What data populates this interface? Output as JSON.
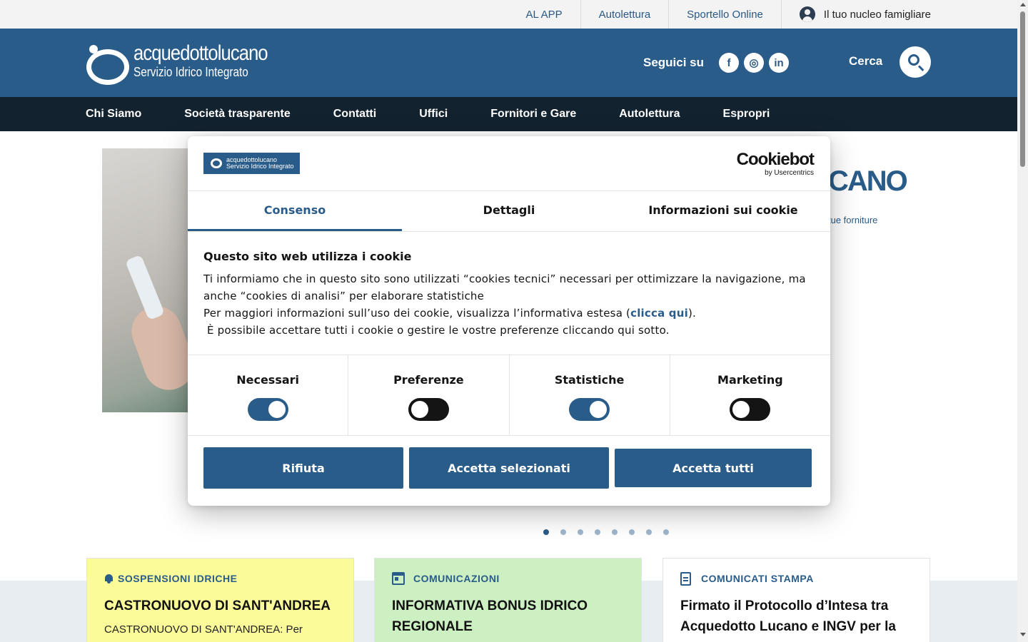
{
  "utility": {
    "links": [
      "AL APP",
      "Autolettura",
      "Sportello Online"
    ],
    "user_label": "Il tuo nucleo famigliare"
  },
  "header": {
    "logo_name_a": "acquedotto",
    "logo_name_b": "lucano",
    "logo_sub": "Servizio Idrico Integrato",
    "follow_label": "Seguici su",
    "social": [
      "f",
      "◎",
      "in"
    ],
    "search_label": "Cerca"
  },
  "nav": {
    "items": [
      "Chi Siamo",
      "Società trasparente",
      "Contatti",
      "Uffici",
      "Fornitori e Gare",
      "Autolettura",
      "Espropri"
    ]
  },
  "hero": {
    "title_fragment": "CANO",
    "subtitle_fragment": "tue forniture"
  },
  "cards": [
    {
      "category": "SOSPENSIONI IDRICHE",
      "title": "CASTRONUOVO DI SANT'ANDREA",
      "text": "CASTRONUOVO DI SANT'ANDREA: Per"
    },
    {
      "category": "COMUNICAZIONI",
      "title": "INFORMATIVA BONUS IDRICO REGIONALE",
      "text": ""
    },
    {
      "category": "COMUNICATI STAMPA",
      "title": "Firmato il Protocollo d’Intesa tra Acquedotto Lucano e INGV per la",
      "text": ""
    }
  ],
  "dialog": {
    "mini_logo_a": "acquedottolucano",
    "mini_logo_b": "Servizio Idrico Integrato",
    "provider_name": "Cookiebot",
    "provider_by": "by Usercentrics",
    "tabs": [
      "Consenso",
      "Dettagli",
      "Informazioni sui cookie"
    ],
    "body_title": "Questo sito web utilizza i cookie",
    "body_line1": "Ti informiamo che in questo sito sono utilizzati “cookies tecnici” necessari per ottimizzare la navigazione, ma anche “cookies di analisi” per elaborare statistiche",
    "body_line2_pre": "Per maggiori informazioni sull’uso dei cookie, visualizza l’informativa estesa (",
    "body_link": "clicca qui",
    "body_line2_post": ").",
    "body_line3": "È possibile accettare tutti i cookie o gestire le vostre preferenze cliccando qui sotto.",
    "toggles": [
      {
        "label": "Necessari",
        "on": true
      },
      {
        "label": "Preferenze",
        "on": false
      },
      {
        "label": "Statistiche",
        "on": true
      },
      {
        "label": "Marketing",
        "on": false
      }
    ],
    "buttons": [
      "Rifiuta",
      "Accetta selezionati",
      "Accetta tutti"
    ]
  },
  "colors": {
    "brand": "#2a5c8a",
    "nav_dark": "#13222f",
    "card_yellow": "#fbfb9a",
    "card_green": "#cdf0c3"
  }
}
